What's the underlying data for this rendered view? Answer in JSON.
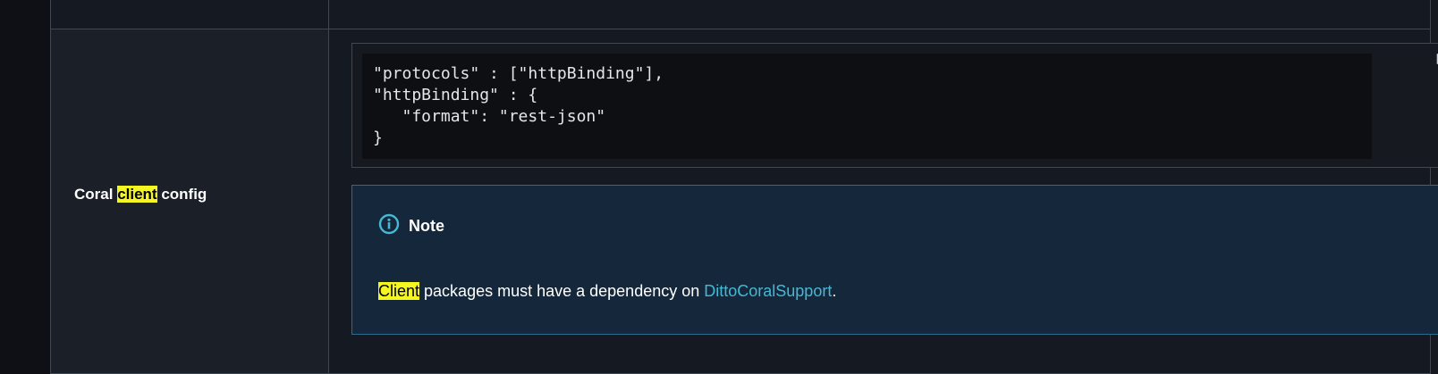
{
  "row": {
    "label_prefix": "Coral ",
    "label_highlight": "client",
    "label_suffix": " config"
  },
  "code": {
    "text": "\"protocols\" : [\"httpBinding\"],\n\"httpBinding\" : {\n   \"format\": \"rest-json\"\n}",
    "copy_icon": "copy-icon"
  },
  "note": {
    "icon": "info-icon",
    "title": "Note",
    "body_highlight": "Client",
    "body_text": " packages must have a dependency on ",
    "link_text": "DittoCoralSupport",
    "body_end": "."
  },
  "colors": {
    "highlight": "#f5f520",
    "link": "#44b9d6",
    "note_border": "#2b6c8e",
    "note_bg": "#15273a",
    "info_icon": "#44b9d6"
  }
}
